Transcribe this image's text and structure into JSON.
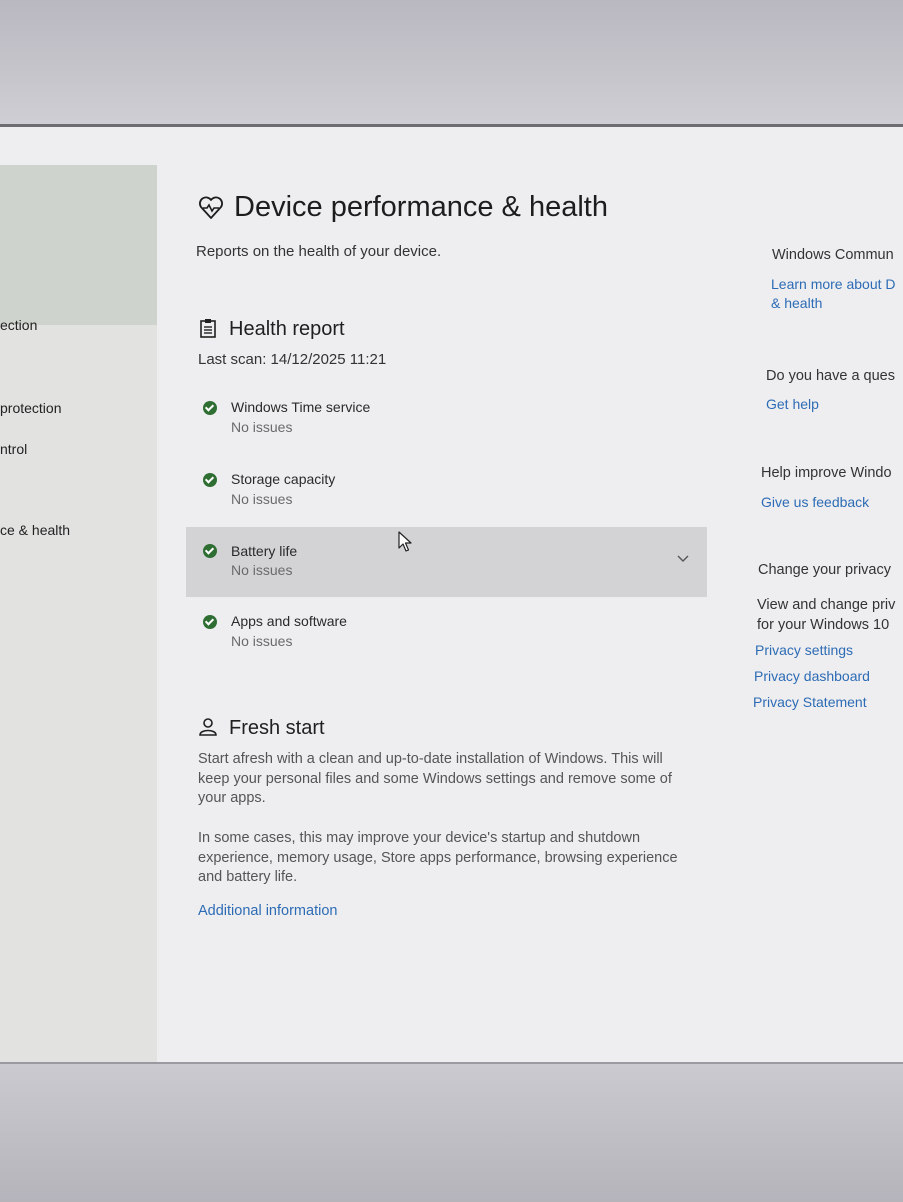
{
  "sidebar": {
    "items": [
      {
        "label": "ection"
      },
      {
        "label": "protection"
      },
      {
        "label": "ntrol"
      },
      {
        "label": "ce & health"
      }
    ]
  },
  "header": {
    "title": "Device performance & health",
    "subtitle": "Reports on the health of your device.",
    "icon": "heart-pulse-icon"
  },
  "health_report": {
    "title": "Health report",
    "icon": "clipboard-icon",
    "last_scan": "Last scan: 14/12/2025 11:21",
    "items": [
      {
        "name": "Windows Time service",
        "status": "No issues",
        "status_color": "#2f6e33"
      },
      {
        "name": "Storage capacity",
        "status": "No issues",
        "status_color": "#2f6e33"
      },
      {
        "name": "Battery life",
        "status": "No issues",
        "status_color": "#2f6e33",
        "selected": true
      },
      {
        "name": "Apps and software",
        "status": "No issues",
        "status_color": "#2f6e33"
      }
    ]
  },
  "fresh_start": {
    "title": "Fresh start",
    "icon": "person-icon",
    "para1": [
      "Start afresh with a clean and up-to-date installation of Windows. This will",
      "keep your personal files and some Windows settings and remove some of",
      "your apps."
    ],
    "para2": [
      "In some cases, this may improve your device's startup and shutdown",
      "experience, memory usage, Store apps performance, browsing experience",
      "and battery life."
    ],
    "link": "Additional information"
  },
  "right_panel": {
    "community_title": "Windows Commun",
    "learn_more": [
      "Learn more about D",
      "& health"
    ],
    "question": "Do you have a ques",
    "get_help": "Get help",
    "improve": "Help improve Windo",
    "feedback": "Give us feedback",
    "privacy_title": "Change your privacy",
    "privacy_desc": [
      "View and change priv",
      "for your Windows 10"
    ],
    "privacy_links": [
      "Privacy settings",
      "Privacy dashboard",
      "Privacy Statement"
    ]
  },
  "colors": {
    "accent_link": "#2d6cb5",
    "ok_green": "#2f6e33",
    "selected_row": "#d3d3d6"
  }
}
